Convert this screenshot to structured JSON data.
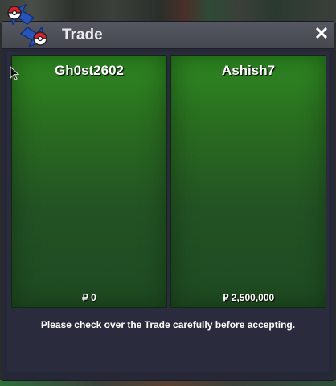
{
  "window": {
    "title": "Trade",
    "close_label": "✕"
  },
  "trade": {
    "left": {
      "player": "Gh0st2602",
      "currency_symbol": "₽",
      "money": "0"
    },
    "right": {
      "player": "Ashish7",
      "currency_symbol": "₽",
      "money": "2,500,000"
    },
    "notice": "Please check over the Trade carefully before accepting."
  },
  "colors": {
    "panel_green": "#2a6e20",
    "window_bg": "#2a2b3c",
    "titlebar": "#4e5058"
  },
  "icons": {
    "logo": "trade-swap-pokeball-icon",
    "close": "close-icon",
    "cursor": "mouse-cursor-icon"
  }
}
